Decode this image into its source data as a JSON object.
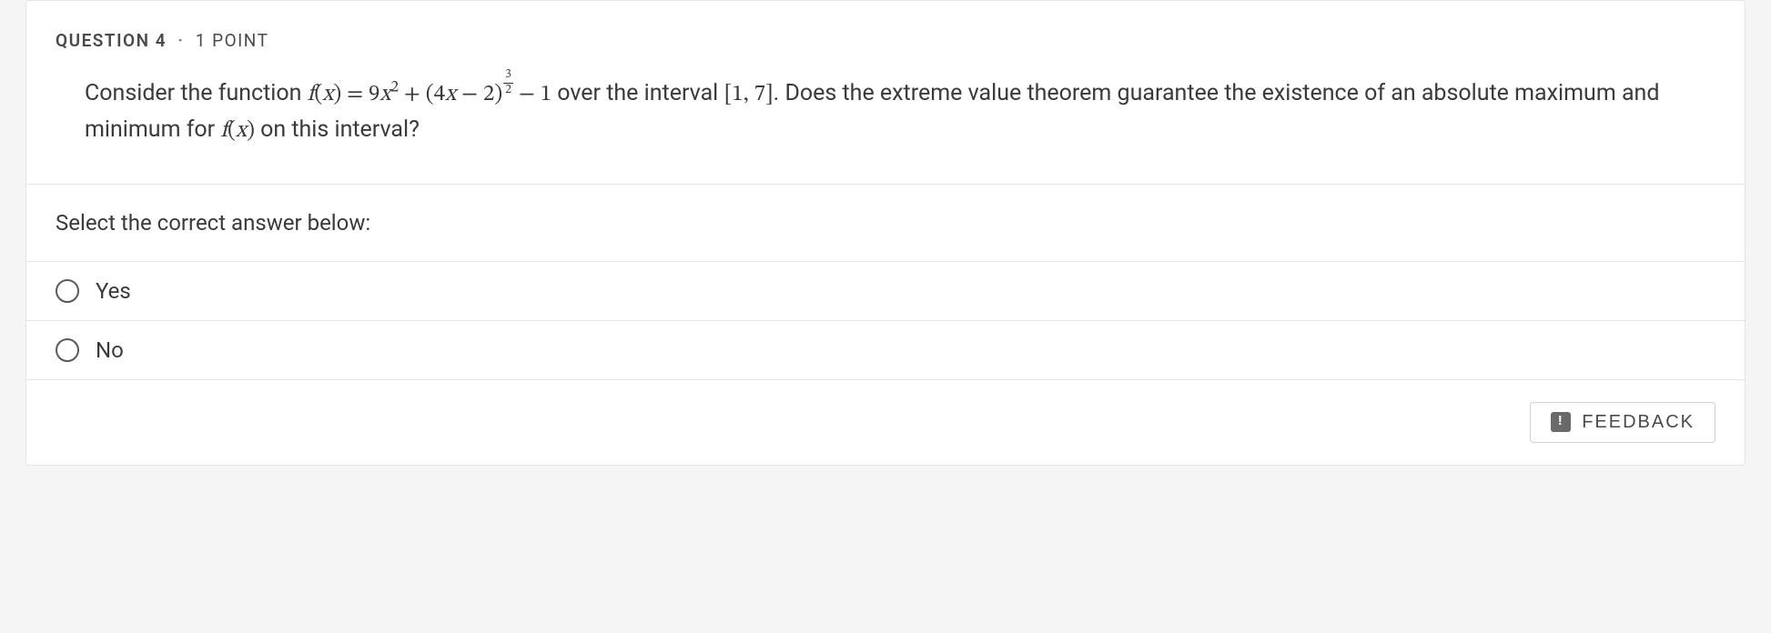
{
  "question": {
    "label": "QUESTION 4",
    "separator": "·",
    "points": "1 POINT",
    "text_parts": {
      "p1": "Consider the function ",
      "p2": " over the interval ",
      "p3": ". Does the extreme value theorem guarantee the existence of an absolute maximum and minimum for ",
      "p4": " on this interval?"
    },
    "math": {
      "lhs_f": "f",
      "lhs_paren_open": "(",
      "lhs_x": "x",
      "lhs_paren_close": ")",
      "eq": " = ",
      "nine": "9",
      "x": "x",
      "sq": "2",
      "plus": " + (4",
      "minus": " − 2)",
      "frac_num": "3",
      "frac_den": "2",
      "minus1": " − 1",
      "interval": "[1, 7]",
      "fx2_f": "f",
      "fx2_open": "(",
      "fx2_x": "x",
      "fx2_close": ")"
    }
  },
  "prompt": "Select the correct answer below:",
  "options": [
    {
      "label": "Yes"
    },
    {
      "label": "No"
    }
  ],
  "feedback": {
    "label": "FEEDBACK"
  }
}
